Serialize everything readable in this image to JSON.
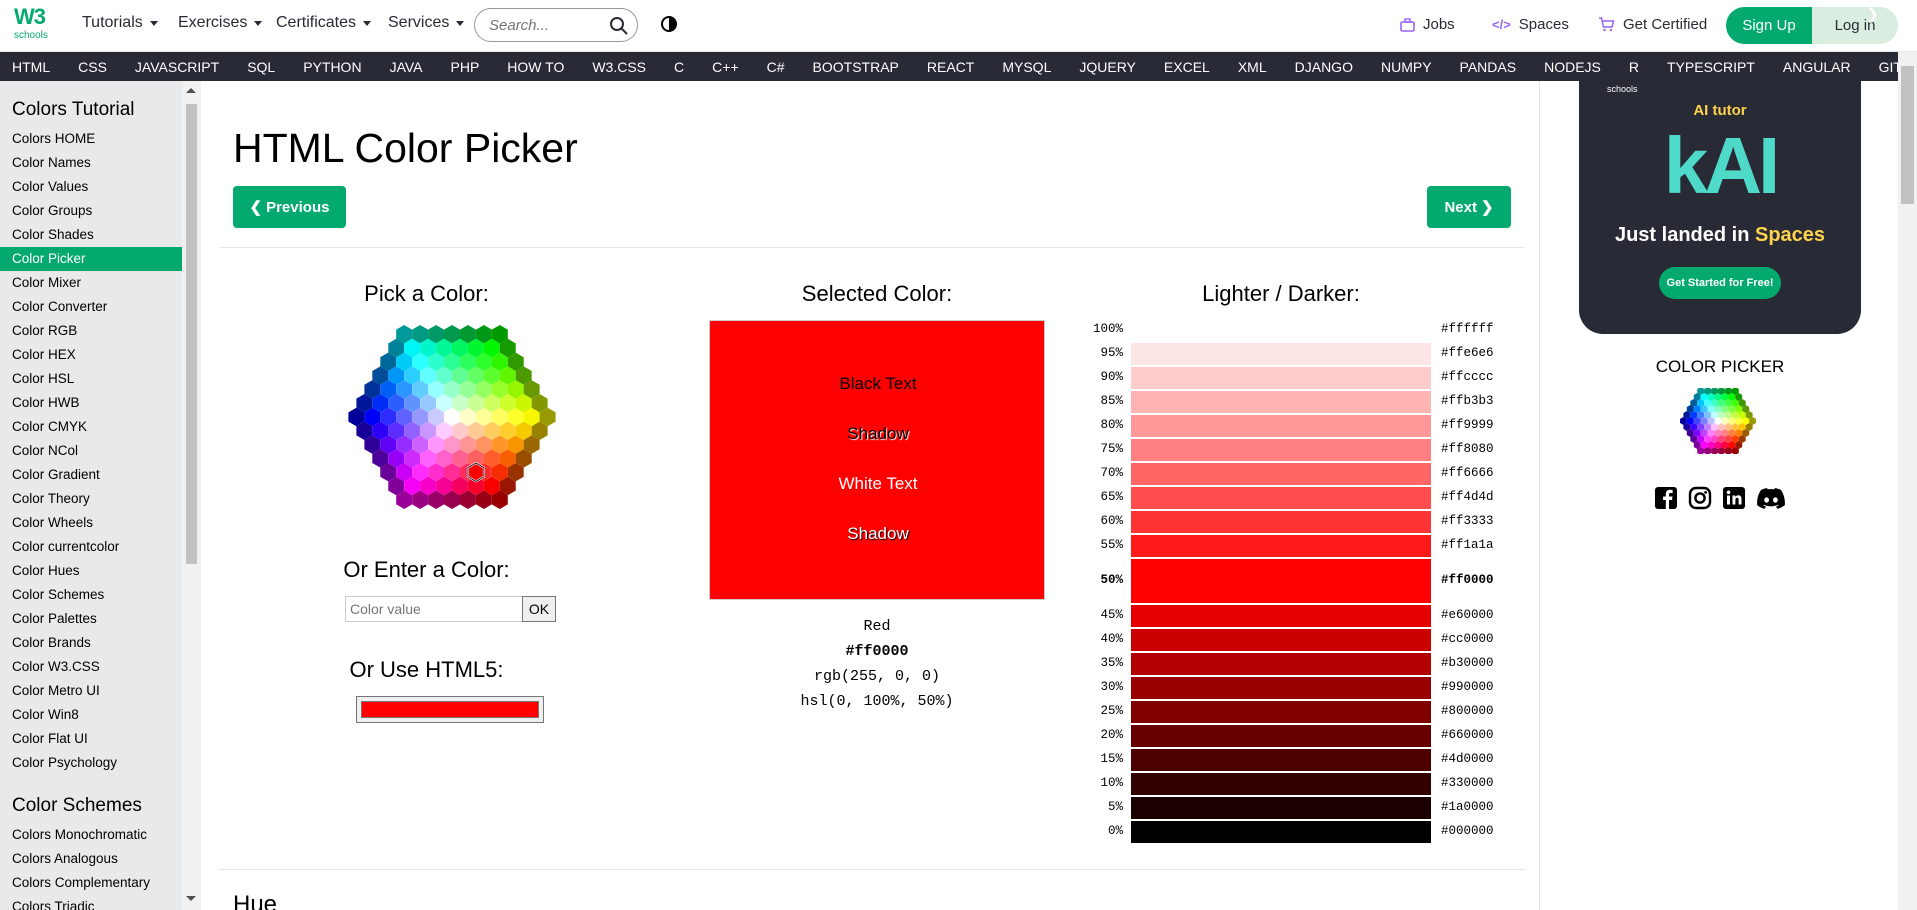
{
  "topnav": {
    "logo_text": "schools",
    "logo_mark": "W3",
    "menus": [
      "Tutorials",
      "Exercises",
      "Certificates",
      "Services"
    ],
    "search_placeholder": "Search...",
    "jobs": "Jobs",
    "spaces": "Spaces",
    "get_certified": "Get Certified",
    "signup": "Sign Up",
    "login": "Log in"
  },
  "langbar": [
    "HTML",
    "CSS",
    "JAVASCRIPT",
    "SQL",
    "PYTHON",
    "JAVA",
    "PHP",
    "HOW TO",
    "W3.CSS",
    "C",
    "C++",
    "C#",
    "BOOTSTRAP",
    "REACT",
    "MYSQL",
    "JQUERY",
    "EXCEL",
    "XML",
    "DJANGO",
    "NUMPY",
    "PANDAS",
    "NODEJS",
    "R",
    "TYPESCRIPT",
    "ANGULAR",
    "GIT"
  ],
  "sidebar": {
    "heading": "Colors Tutorial",
    "items": [
      "Colors HOME",
      "Color Names",
      "Color Values",
      "Color Groups",
      "Color Shades",
      "Color Picker",
      "Color Mixer",
      "Color Converter",
      "Color RGB",
      "Color HEX",
      "Color HSL",
      "Color HWB",
      "Color CMYK",
      "Color NCol",
      "Color Gradient",
      "Color Theory",
      "Color Wheels",
      "Color currentcolor",
      "Color Hues",
      "Color Schemes",
      "Color Palettes",
      "Color Brands",
      "Color W3.CSS",
      "Color Metro UI",
      "Color Win8",
      "Color Flat UI",
      "Color Psychology"
    ],
    "active_index": 5,
    "heading2": "Color Schemes",
    "items2": [
      "Colors Monochromatic",
      "Colors Analogous",
      "Colors Complementary",
      "Colors Triadic"
    ]
  },
  "main": {
    "title": "HTML Color Picker",
    "prev": "Previous",
    "next": "Next",
    "pick_heading": "Pick a Color:",
    "enter_heading": "Or Enter a Color:",
    "input_placeholder": "Color value",
    "ok": "OK",
    "html5_heading": "Or Use HTML5:",
    "html5_value": "#ff0000",
    "selected_heading": "Selected Color:",
    "swatch_color": "#ff0000",
    "swatch_texts": [
      "Black Text",
      "Shadow",
      "White Text",
      "Shadow"
    ],
    "color_name": "Red",
    "color_hex": "#ff0000",
    "color_rgb": "rgb(255, 0, 0)",
    "color_hsl": "hsl(0, 100%, 50%)",
    "shades_heading": "Lighter / Darker:",
    "shades": [
      {
        "pct": "100%",
        "hex": "#ffffff"
      },
      {
        "pct": "95%",
        "hex": "#ffe6e6"
      },
      {
        "pct": "90%",
        "hex": "#ffcccc"
      },
      {
        "pct": "85%",
        "hex": "#ffb3b3"
      },
      {
        "pct": "80%",
        "hex": "#ff9999"
      },
      {
        "pct": "75%",
        "hex": "#ff8080"
      },
      {
        "pct": "70%",
        "hex": "#ff6666"
      },
      {
        "pct": "65%",
        "hex": "#ff4d4d"
      },
      {
        "pct": "60%",
        "hex": "#ff3333"
      },
      {
        "pct": "55%",
        "hex": "#ff1a1a"
      },
      {
        "pct": "50%",
        "hex": "#ff0000"
      },
      {
        "pct": "45%",
        "hex": "#e60000"
      },
      {
        "pct": "40%",
        "hex": "#cc0000"
      },
      {
        "pct": "35%",
        "hex": "#b30000"
      },
      {
        "pct": "30%",
        "hex": "#990000"
      },
      {
        "pct": "25%",
        "hex": "#800000"
      },
      {
        "pct": "20%",
        "hex": "#660000"
      },
      {
        "pct": "15%",
        "hex": "#4d0000"
      },
      {
        "pct": "10%",
        "hex": "#330000"
      },
      {
        "pct": "5%",
        "hex": "#1a0000"
      },
      {
        "pct": "0%",
        "hex": "#000000"
      }
    ],
    "hue_heading": "Hue"
  },
  "right": {
    "ad_logo": "schools",
    "ad_tutor": "AI tutor",
    "ad_kai": "kAI",
    "ad_landed": "Just landed in ",
    "ad_landed_accent": "Spaces",
    "ad_cta": "Get Started for Free!",
    "cp_title": "COLOR PICKER"
  },
  "colors": {
    "brand": "#04aa6d",
    "dark": "#282a35",
    "sidebar": "#e7e9eb"
  }
}
